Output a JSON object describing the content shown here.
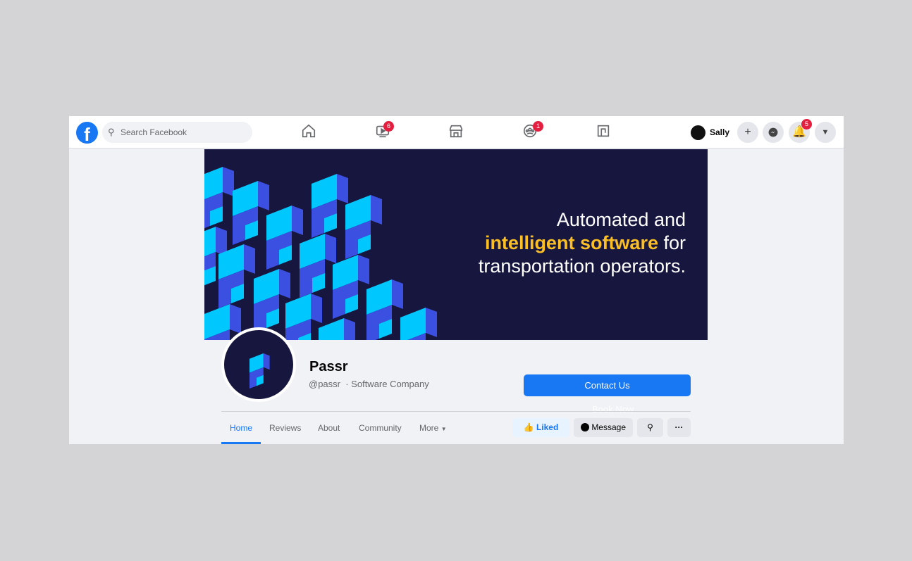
{
  "topbar": {
    "search_placeholder": "Search Facebook",
    "user_name": "Sally",
    "badges": {
      "watch": "6",
      "groups": "1",
      "notifications": "5"
    }
  },
  "cover": {
    "line1": "Automated and",
    "line2_highlight": "intelligent software",
    "line2_rest": " for",
    "line3": "transportation operators.",
    "bg_color": "#16163f",
    "accent_color": "#fbbf24"
  },
  "page": {
    "name": "Passr",
    "handle": "@passr",
    "category": "· Software Company"
  },
  "actions": {
    "contact": "Contact Us",
    "book": "Book Now",
    "liked": "Liked",
    "message": "Message",
    "more_dots": "···"
  },
  "tabs": [
    {
      "label": "Home"
    },
    {
      "label": "Reviews"
    },
    {
      "label": "About"
    },
    {
      "label": "Community"
    },
    {
      "label": "More"
    }
  ],
  "colors": {
    "brand": "#1877f2",
    "badge": "#e41e3f"
  }
}
